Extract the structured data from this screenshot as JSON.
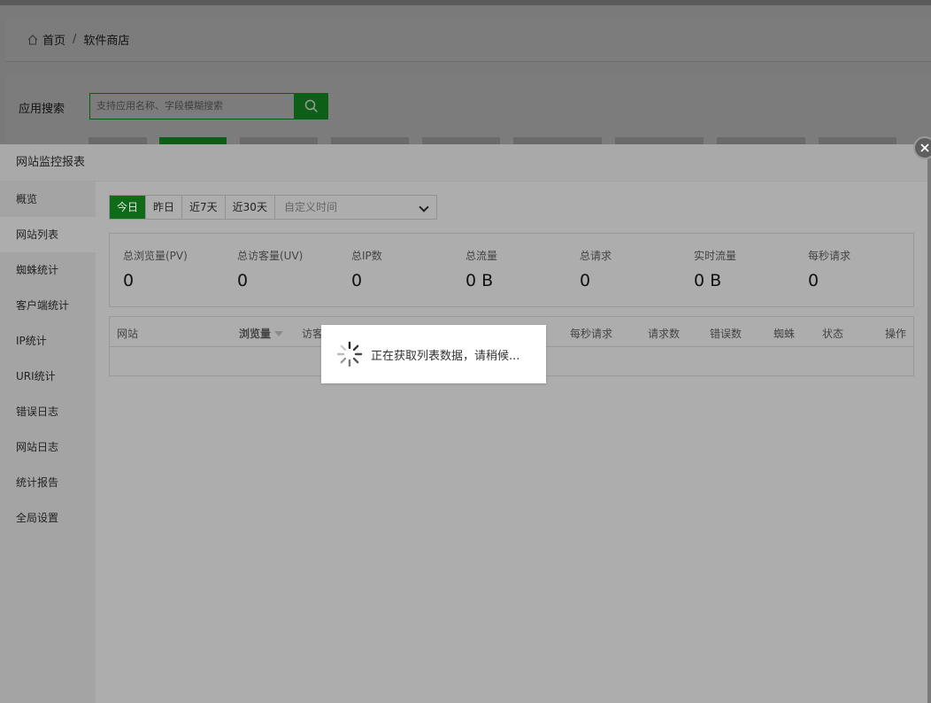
{
  "breadcrumb": {
    "home": "首页",
    "separator": "/",
    "current": "软件商店"
  },
  "search": {
    "label": "应用搜索",
    "placeholder": "支持应用名称、字段模糊搜索"
  },
  "modal": {
    "title": "网站监控报表",
    "sidebar": [
      "概览",
      "网站列表",
      "蜘蛛统计",
      "客户端统计",
      "IP统计",
      "URI统计",
      "错误日志",
      "网站日志",
      "统计报告",
      "全局设置"
    ],
    "sidebar_active": "网站列表",
    "date_options": [
      "今日",
      "昨日",
      "近7天",
      "近30天"
    ],
    "date_active": "今日",
    "custom_time": "自定义时间",
    "stats": [
      {
        "label": "总浏览量(PV)",
        "value": "0"
      },
      {
        "label": "总访客量(UV)",
        "value": "0"
      },
      {
        "label": "总IP数",
        "value": "0"
      },
      {
        "label": "总流量",
        "value": "0 B"
      },
      {
        "label": "总请求",
        "value": "0"
      },
      {
        "label": "实时流量",
        "value": "0 B"
      },
      {
        "label": "每秒请求",
        "value": "0"
      }
    ],
    "table_headers": [
      "网站",
      "浏览量",
      "访客",
      "每秒请求",
      "请求数",
      "错误数",
      "蜘蛛",
      "状态",
      "操作"
    ]
  },
  "loading_text": "正在获取列表数据，请稍候...",
  "colors": {
    "accent": "#20a53a",
    "overlay": "#adadad"
  }
}
